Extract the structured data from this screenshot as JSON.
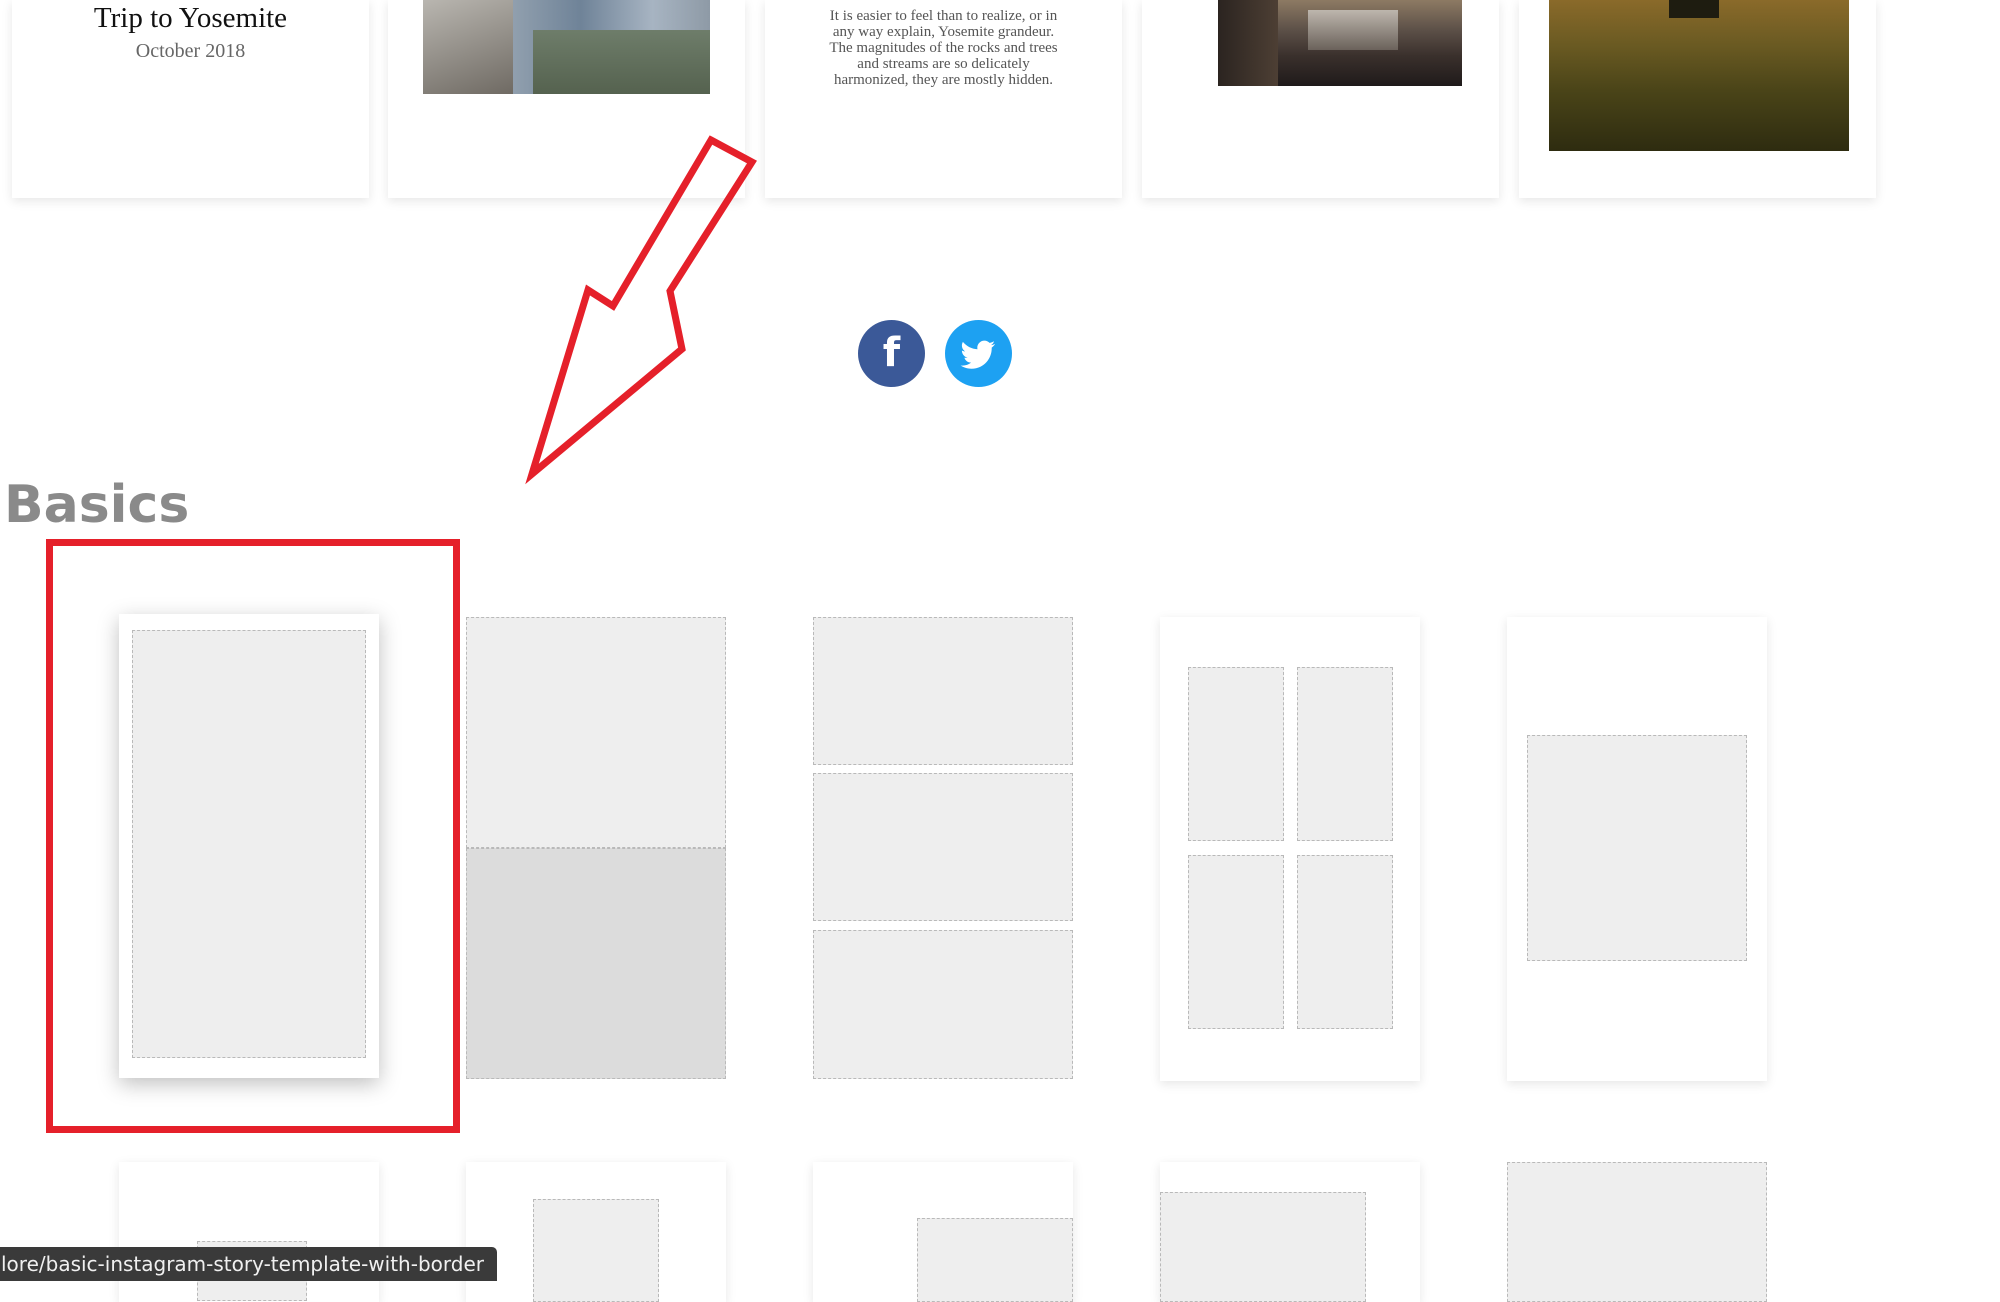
{
  "top_cards": [
    {
      "title": "Trip to Yosemite",
      "subtitle": "October 2018"
    },
    {
      "image": "rocky-cliff-valley-photo"
    },
    {
      "quote": "It is easier to feel than to realize, or in any way explain, Yosemite grandeur. The magnitudes of the rocks and trees and streams are so delicately harmonized, they are mostly hidden."
    },
    {
      "image": "yosemite-valley-sunset-photo"
    },
    {
      "image": "grass-meadow-sunset-photo"
    }
  ],
  "social": {
    "facebook_glyph": "f",
    "facebook_color": "#3b5998",
    "twitter_color": "#1da1f2"
  },
  "section": {
    "title": "Basics"
  },
  "annotation": {
    "color": "#e5202a"
  },
  "status_bar": {
    "url": "lore/basic-instagram-story-template-with-border"
  }
}
